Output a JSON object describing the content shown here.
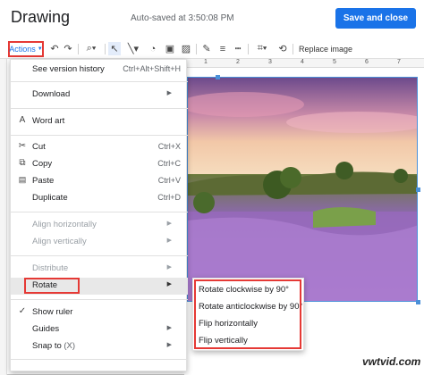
{
  "header": {
    "title": "Drawing",
    "autosave": "Auto-saved at 3:50:08 PM",
    "primary_button": "Save and close"
  },
  "toolbar": {
    "actions_label": "Actions",
    "replace_image": "Replace image",
    "icons": [
      "undo-icon",
      "redo-icon",
      "zoom-icon",
      "select-icon",
      "line-icon",
      "shape-icon",
      "text-box-icon",
      "image-icon",
      "pen-icon",
      "line-weight-icon",
      "line-dash-icon",
      "crop-icon",
      "reset-image-icon"
    ]
  },
  "ruler": {
    "top_numbers": [
      "1",
      "2",
      "3",
      "4",
      "5",
      "6",
      "7"
    ]
  },
  "menu": {
    "items": [
      {
        "label": "See version history",
        "shortcut": "Ctrl+Alt+Shift+H",
        "icon": ""
      },
      {
        "label": "Download",
        "submenu": true
      },
      {
        "label": "Word art",
        "icon": "A"
      },
      {
        "label": "Cut",
        "shortcut": "Ctrl+X",
        "icon": "✂"
      },
      {
        "label": "Copy",
        "shortcut": "Ctrl+C",
        "icon": "⧉"
      },
      {
        "label": "Paste",
        "shortcut": "Ctrl+V",
        "icon": "📋"
      },
      {
        "label": "Duplicate",
        "shortcut": "Ctrl+D"
      },
      {
        "label": "Align horizontally",
        "submenu": true,
        "disabled": true
      },
      {
        "label": "Align vertically",
        "submenu": true,
        "disabled": true
      },
      {
        "label": "Distribute",
        "submenu": true,
        "disabled": true
      },
      {
        "label": "Rotate",
        "submenu": true,
        "highlighted": true
      },
      {
        "label": "Show ruler",
        "checked": true
      },
      {
        "label": "Guides",
        "submenu": true
      },
      {
        "label": "Snap to",
        "suffix": "(X)",
        "submenu": true
      }
    ]
  },
  "rotate_submenu": {
    "items": [
      "Rotate clockwise by 90°",
      "Rotate anticlockwise by 90°",
      "Flip horizontally",
      "Flip vertically"
    ]
  },
  "watermark": "vwtvid.com",
  "colors": {
    "accent": "#1a73e8",
    "annotation": "#e53935"
  }
}
